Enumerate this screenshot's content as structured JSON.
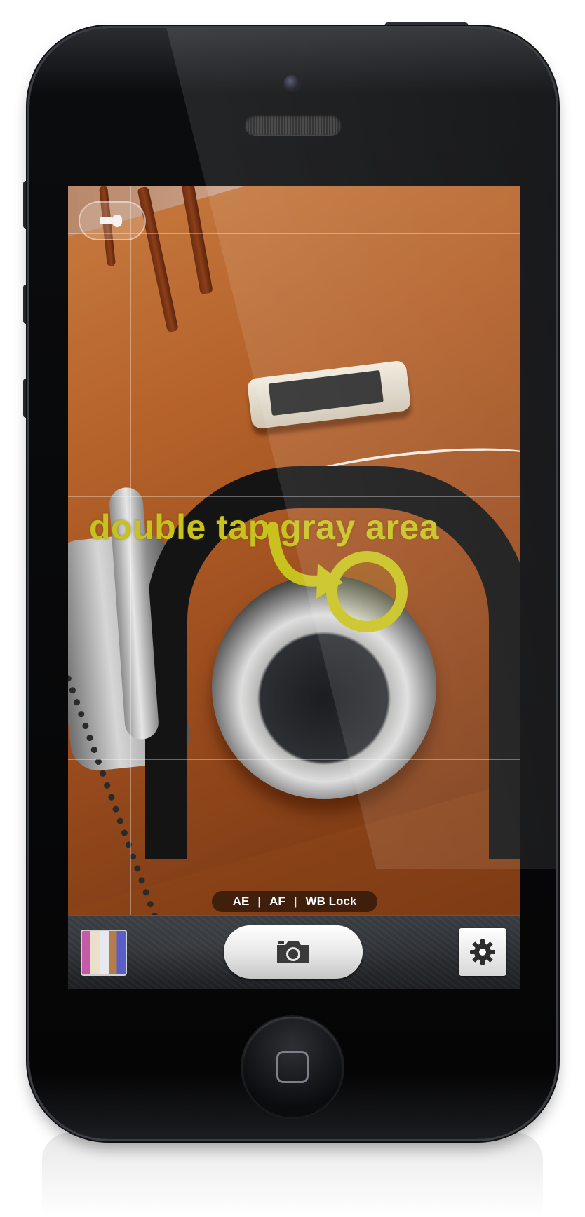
{
  "overlay": {
    "instruction_text": "double tap gray area",
    "highlight_color": "#c8c21e"
  },
  "lock_bar": {
    "ae_label": "AE",
    "af_label": "AF",
    "wb_label": "WB Lock",
    "separator": "|"
  },
  "toolbar": {
    "thumbnail_icon": "photo-thumbnail",
    "shutter_icon": "camera-icon",
    "settings_icon": "gear-icon"
  },
  "viewfinder": {
    "flash_icon": "flash-toggle-icon",
    "grid": true
  },
  "colors": {
    "accent": "#c8c21e",
    "toolbar_bg": "#2a2d31"
  }
}
